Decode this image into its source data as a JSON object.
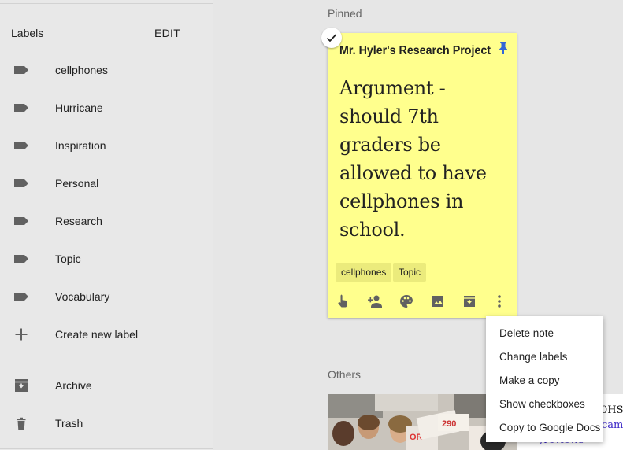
{
  "sidebar": {
    "labels_title": "Labels",
    "edit_label": "EDIT",
    "labels": [
      {
        "label": "cellphones"
      },
      {
        "label": "Hurricane"
      },
      {
        "label": "Inspiration"
      },
      {
        "label": "Personal"
      },
      {
        "label": "Research"
      },
      {
        "label": "Topic"
      },
      {
        "label": "Vocabulary"
      }
    ],
    "create_label": "Create new label",
    "archive_label": "Archive",
    "trash_label": "Trash"
  },
  "main": {
    "pinned_label": "Pinned",
    "others_label": "Others",
    "note": {
      "title": "Mr. Hyler's Research Project",
      "body": "Argument - should 7th graders be allowed to have cellphones in school.",
      "color": "#ffff8d",
      "chips": [
        "cellphones",
        "Topic"
      ],
      "toolbar_icons": [
        "reminder-icon",
        "collaborator-icon",
        "palette-icon",
        "image-icon",
        "archive-icon",
        "more-vert-icon"
      ]
    },
    "context_menu": {
      "items": [
        "Delete note",
        "Change labels",
        "Make a copy",
        "Show checkboxes",
        "Copy to Google Docs"
      ]
    },
    "snippet": {
      "line1": "0HS",
      "line2": "cam",
      "line3": "/reviews"
    }
  },
  "colors": {
    "background": "#e6e6e6",
    "note_yellow": "#ffff8d",
    "pin_blue": "#3367d6",
    "icon_grey": "#616161"
  }
}
